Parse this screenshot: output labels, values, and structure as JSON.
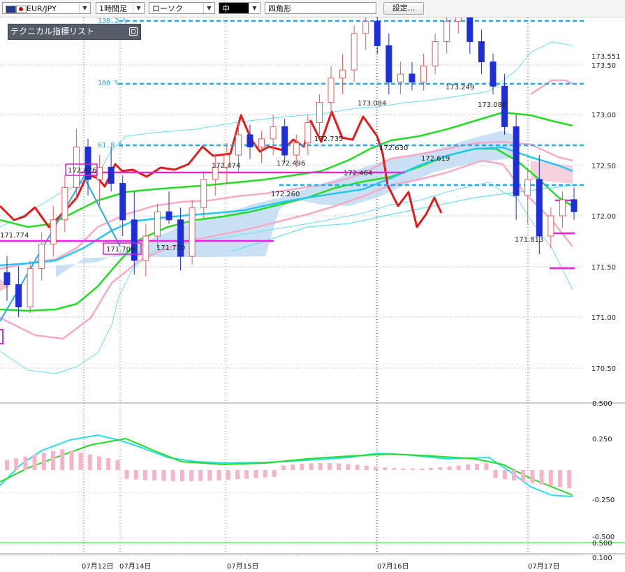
{
  "toolbar": {
    "symbol_select": "EUR/JPY",
    "timeframe_select": "1時間足",
    "chart_type_select": "ローソク",
    "line_width_select": "中",
    "draw_tool_label": "四角形",
    "settings_button": "設定..."
  },
  "indicator_panel": {
    "title": "テクニカル指標リスト"
  },
  "chart_data": {
    "type": "candlestick",
    "price_axis_labels": [
      "173.551",
      "173.50",
      "173.00",
      "172.50",
      "172.00",
      "171.50",
      "171.00",
      "170.50"
    ],
    "oscillator_axis_labels": [
      "0.500",
      "0.250",
      "-0.250",
      "-0.500",
      "0.500",
      "0.100"
    ],
    "x_tick_labels": [
      "07月12日",
      "07月14日",
      "07月15日",
      "07月16日",
      "07月17日"
    ],
    "fib_labels": [
      "138.2 %",
      "100 %",
      "61.8 %"
    ],
    "annotations": [
      "171.774",
      "172.426",
      "171.709",
      "171.730",
      "172.474",
      "172.496",
      "172.260",
      "172.735",
      "173.084",
      "172.464",
      "172.630",
      "173.249",
      "173.088",
      "172.619",
      "171.813"
    ],
    "candles": [
      {
        "o": 171.72,
        "h": 171.8,
        "l": 171.58,
        "c": 171.66
      },
      {
        "o": 171.66,
        "h": 171.75,
        "l": 171.5,
        "c": 171.55
      },
      {
        "o": 171.55,
        "h": 171.78,
        "l": 171.52,
        "c": 171.74
      },
      {
        "o": 171.74,
        "h": 171.92,
        "l": 171.68,
        "c": 171.86
      },
      {
        "o": 171.86,
        "h": 172.05,
        "l": 171.8,
        "c": 171.98
      },
      {
        "o": 171.98,
        "h": 172.2,
        "l": 171.92,
        "c": 172.14
      },
      {
        "o": 172.14,
        "h": 172.43,
        "l": 172.08,
        "c": 172.34
      },
      {
        "o": 172.34,
        "h": 172.38,
        "l": 172.1,
        "c": 172.18
      },
      {
        "o": 172.18,
        "h": 172.3,
        "l": 172.05,
        "c": 172.24
      },
      {
        "o": 172.24,
        "h": 172.34,
        "l": 172.12,
        "c": 172.16
      },
      {
        "o": 172.16,
        "h": 172.2,
        "l": 171.9,
        "c": 171.98
      },
      {
        "o": 171.98,
        "h": 172.12,
        "l": 171.71,
        "c": 171.78
      },
      {
        "o": 171.78,
        "h": 171.96,
        "l": 171.7,
        "c": 171.9
      },
      {
        "o": 171.9,
        "h": 172.06,
        "l": 171.84,
        "c": 172.02
      },
      {
        "o": 172.02,
        "h": 172.12,
        "l": 171.96,
        "c": 171.98
      },
      {
        "o": 171.98,
        "h": 172.04,
        "l": 171.73,
        "c": 171.8
      },
      {
        "o": 171.8,
        "h": 172.08,
        "l": 171.76,
        "c": 172.04
      },
      {
        "o": 172.04,
        "h": 172.22,
        "l": 171.98,
        "c": 172.18
      },
      {
        "o": 172.18,
        "h": 172.3,
        "l": 172.1,
        "c": 172.24
      },
      {
        "o": 172.24,
        "h": 172.36,
        "l": 172.16,
        "c": 172.3
      },
      {
        "o": 172.3,
        "h": 172.47,
        "l": 172.22,
        "c": 172.4
      },
      {
        "o": 172.4,
        "h": 172.45,
        "l": 172.28,
        "c": 172.34
      },
      {
        "o": 172.34,
        "h": 172.42,
        "l": 172.26,
        "c": 172.38
      },
      {
        "o": 172.38,
        "h": 172.5,
        "l": 172.3,
        "c": 172.44
      },
      {
        "o": 172.44,
        "h": 172.48,
        "l": 172.26,
        "c": 172.3
      },
      {
        "o": 172.3,
        "h": 172.4,
        "l": 172.24,
        "c": 172.36
      },
      {
        "o": 172.36,
        "h": 172.5,
        "l": 172.3,
        "c": 172.46
      },
      {
        "o": 172.46,
        "h": 172.6,
        "l": 172.4,
        "c": 172.56
      },
      {
        "o": 172.56,
        "h": 172.74,
        "l": 172.5,
        "c": 172.68
      },
      {
        "o": 172.68,
        "h": 172.8,
        "l": 172.6,
        "c": 172.72
      },
      {
        "o": 172.72,
        "h": 172.94,
        "l": 172.66,
        "c": 172.9
      },
      {
        "o": 172.9,
        "h": 173.08,
        "l": 172.82,
        "c": 172.96
      },
      {
        "o": 172.96,
        "h": 173.02,
        "l": 172.8,
        "c": 172.84
      },
      {
        "o": 172.84,
        "h": 172.9,
        "l": 172.6,
        "c": 172.66
      },
      {
        "o": 172.66,
        "h": 172.76,
        "l": 172.6,
        "c": 172.7
      },
      {
        "o": 172.7,
        "h": 172.76,
        "l": 172.62,
        "c": 172.66
      },
      {
        "o": 172.66,
        "h": 172.8,
        "l": 172.62,
        "c": 172.74
      },
      {
        "o": 172.74,
        "h": 172.9,
        "l": 172.7,
        "c": 172.86
      },
      {
        "o": 172.86,
        "h": 173.0,
        "l": 172.8,
        "c": 172.96
      },
      {
        "o": 172.96,
        "h": 173.25,
        "l": 172.9,
        "c": 173.0
      },
      {
        "o": 173.0,
        "h": 173.09,
        "l": 172.8,
        "c": 172.86
      },
      {
        "o": 172.86,
        "h": 172.92,
        "l": 172.7,
        "c": 172.76
      },
      {
        "o": 172.76,
        "h": 172.8,
        "l": 172.6,
        "c": 172.64
      },
      {
        "o": 172.64,
        "h": 172.7,
        "l": 172.4,
        "c": 172.44
      },
      {
        "o": 172.44,
        "h": 172.5,
        "l": 171.98,
        "c": 172.1
      },
      {
        "o": 172.1,
        "h": 172.24,
        "l": 171.96,
        "c": 172.18
      },
      {
        "o": 172.18,
        "h": 172.3,
        "l": 171.81,
        "c": 171.9
      },
      {
        "o": 171.9,
        "h": 172.04,
        "l": 171.84,
        "c": 172.0
      },
      {
        "o": 172.0,
        "h": 172.12,
        "l": 171.94,
        "c": 172.08
      },
      {
        "o": 172.08,
        "h": 172.14,
        "l": 171.98,
        "c": 172.02
      }
    ]
  }
}
